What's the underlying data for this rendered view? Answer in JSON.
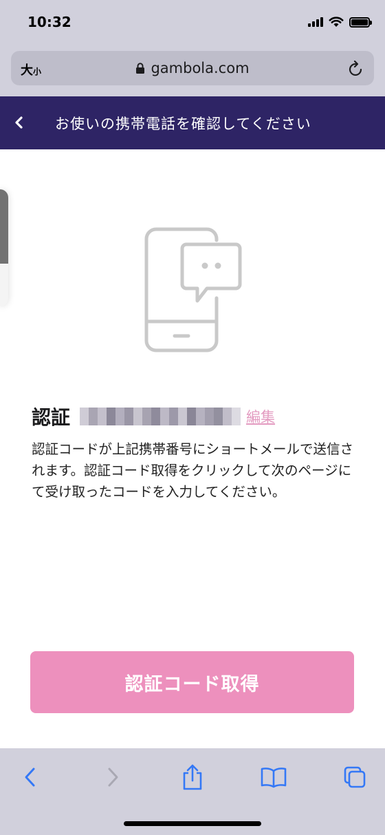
{
  "status_bar": {
    "time": "10:32"
  },
  "address_bar": {
    "text_size_label": "大",
    "text_size_small": "小",
    "url": "gambola.com"
  },
  "header": {
    "title": "お使いの携帯電話を確認してください"
  },
  "main": {
    "verify_label": "認証",
    "edit_link": "編集",
    "description": "認証コードが上記携帯番号にショートメールで送信されます。認証コード取得をクリックして次のページにて受け取ったコードを入力してください。",
    "submit_button": "認証コード取得"
  },
  "colors": {
    "header_bg": "#2e2465",
    "button_bg": "#ed90bd",
    "link": "#e39ac0",
    "ios_blue": "#3478f6"
  },
  "icons": {
    "lock": "lock-icon",
    "reload": "reload-icon",
    "back": "chevron-left-icon",
    "illustration": "phone-message-icon",
    "toolbar": [
      "chevron-left-icon",
      "chevron-right-icon",
      "share-icon",
      "bookmarks-icon",
      "tabs-icon"
    ]
  }
}
